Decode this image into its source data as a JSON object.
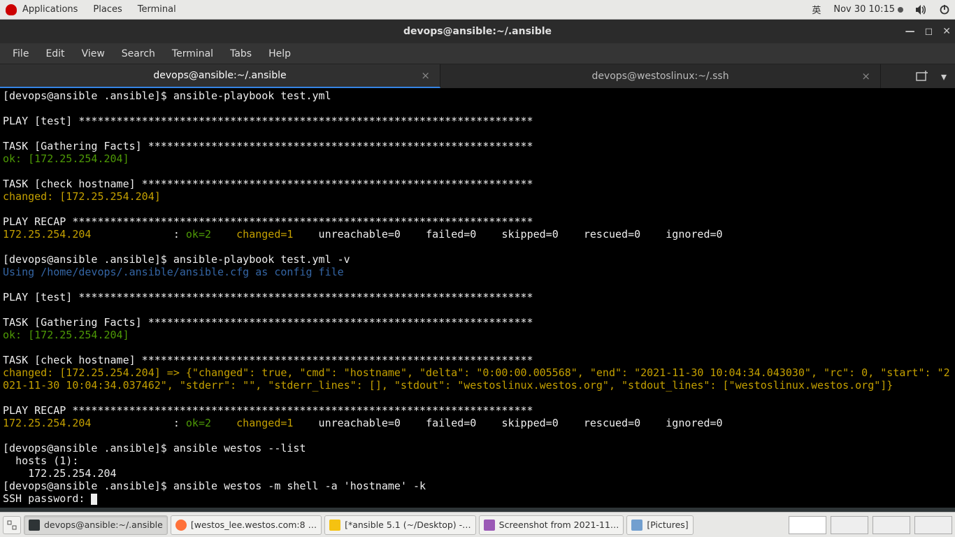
{
  "topbar": {
    "applications": "Applications",
    "places": "Places",
    "terminal": "Terminal",
    "ime": "英",
    "datetime": "Nov 30  10:15"
  },
  "window": {
    "title": "devops@ansible:~/.ansible",
    "menu": {
      "file": "File",
      "edit": "Edit",
      "view": "View",
      "search": "Search",
      "terminal": "Terminal",
      "tabs": "Tabs",
      "help": "Help"
    },
    "tabs": [
      {
        "label": "devops@ansible:~/.ansible"
      },
      {
        "label": "devops@westoslinux:~/.ssh"
      }
    ]
  },
  "term": {
    "prompt1": "[devops@ansible .ansible]$ ",
    "cmd1": "ansible-playbook test.yml",
    "play_header": "PLAY [test] ************************************************************************",
    "task_gather": "TASK [Gathering Facts] *************************************************************",
    "ok_host": "ok: [172.25.254.204]",
    "task_check": "TASK [check hostname] **************************************************************",
    "changed_host": "changed: [172.25.254.204]",
    "recap_header": "PLAY RECAP *************************************************************************",
    "recap_host": "172.25.254.204",
    "recap_colon": "             : ",
    "recap_ok": "ok=2   ",
    "recap_changed": " changed=1   ",
    "recap_rest": " unreachable=0    failed=0    skipped=0    rescued=0    ignored=0",
    "cmd2": "ansible-playbook test.yml -v",
    "cfg_line": "Using /home/devops/.ansible/ansible.cfg as config file",
    "changed_verbose": "changed: [172.25.254.204] => {\"changed\": true, \"cmd\": \"hostname\", \"delta\": \"0:00:00.005568\", \"end\": \"2021-11-30 10:04:34.043030\", \"rc\": 0, \"start\": \"2021-11-30 10:04:34.037462\", \"stderr\": \"\", \"stderr_lines\": [], \"stdout\": \"westoslinux.westos.org\", \"stdout_lines\": [\"westoslinux.westos.org\"]}",
    "cmd3": "ansible westos --list",
    "hosts_line": "  hosts (1):",
    "hosts_ip": "    172.25.254.204",
    "cmd4": "ansible westos -m shell -a 'hostname' -k",
    "ssh_pw": "SSH password: "
  },
  "taskbar": {
    "items": [
      "devops@ansible:~/.ansible",
      "[westos_lee.westos.com:8 …",
      "[*ansible 5.1 (~/Desktop) -…",
      "Screenshot from 2021-11…",
      "[Pictures]"
    ]
  }
}
